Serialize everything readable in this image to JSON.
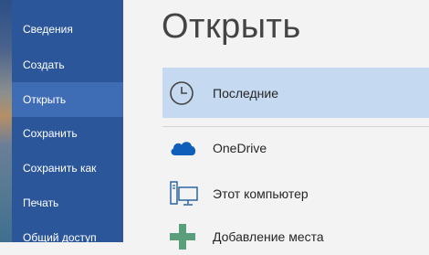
{
  "sidebar": {
    "items": [
      {
        "label": "Сведения"
      },
      {
        "label": "Создать"
      },
      {
        "label": "Открыть"
      },
      {
        "label": "Сохранить"
      },
      {
        "label": "Сохранить как"
      },
      {
        "label": "Печать"
      },
      {
        "label": "Общий доступ"
      }
    ],
    "active": "Открыть"
  },
  "main": {
    "title": "Открыть",
    "locations": [
      {
        "label": "Последние",
        "icon": "clock-icon",
        "selected": true
      },
      {
        "label": "OneDrive",
        "icon": "cloud-icon"
      },
      {
        "label": "Этот компьютер",
        "icon": "computer-icon"
      },
      {
        "label": "Добавление места",
        "icon": "plus-icon"
      }
    ]
  },
  "colors": {
    "sidebar": "#2b579a",
    "sidebar_active": "#3e6db5",
    "selected_row": "#c5d9f1",
    "onedrive_blue": "#0f5fb8",
    "add_green": "#5a9e7c"
  }
}
